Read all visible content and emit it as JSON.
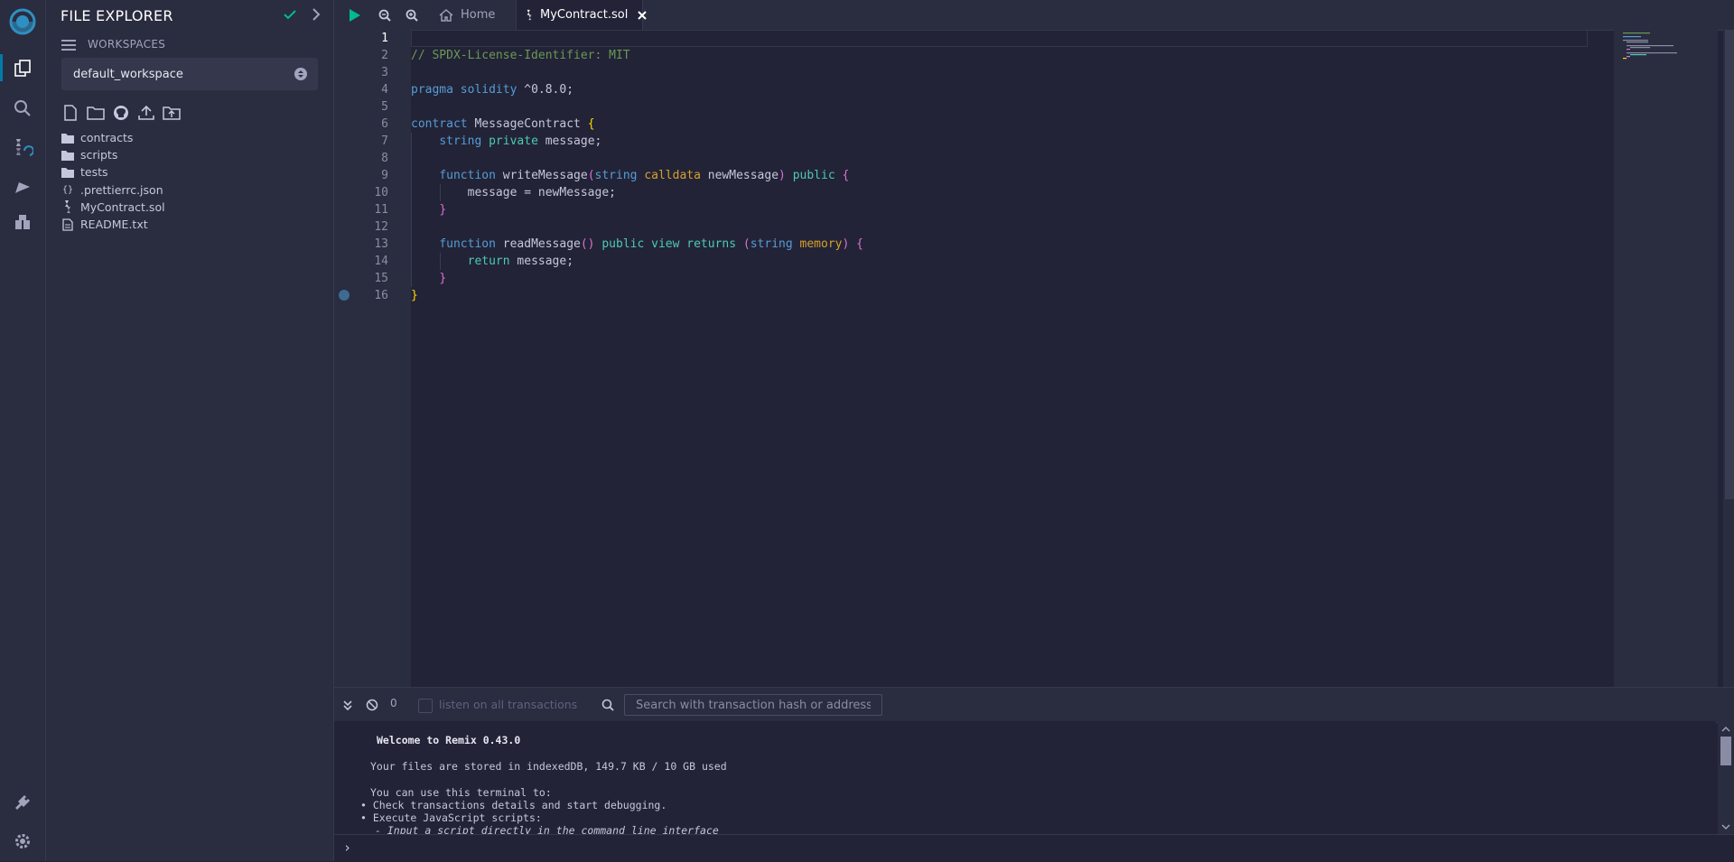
{
  "sidepanel": {
    "title": "FILE EXPLORER",
    "workspaces_label": "WORKSPACES",
    "workspace_selected": "default_workspace",
    "tree": [
      {
        "label": "contracts",
        "icon": "folder-icon"
      },
      {
        "label": "scripts",
        "icon": "folder-icon"
      },
      {
        "label": "tests",
        "icon": "folder-icon"
      },
      {
        "label": ".prettierrc.json",
        "icon": "braces-icon"
      },
      {
        "label": "MyContract.sol",
        "icon": "solidity-icon"
      },
      {
        "label": "README.txt",
        "icon": "file-text-icon"
      }
    ]
  },
  "editor": {
    "tabs": {
      "home": "Home",
      "file": "MyContract.sol"
    },
    "current_line": 1,
    "lines": [
      "1",
      "2",
      "3",
      "4",
      "5",
      "6",
      "7",
      "8",
      "9",
      "10",
      "11",
      "12",
      "13",
      "14",
      "15",
      "16"
    ],
    "code": {
      "l2": "// SPDX-License-Identifier: MIT",
      "l4_kw": "pragma",
      "l4_kw2": "solidity",
      "l4_rest": "^0.8.0;",
      "l6_kw": "contract",
      "l6_name": "MessageContract",
      "l7_type": "string",
      "l7_vis": "private",
      "l7_name": "message;",
      "l9_kw": "function",
      "l9_name": "writeMessage",
      "l9_type": "string",
      "l9_loc": "calldata",
      "l9_param": "newMessage",
      "l9_vis": "public",
      "l10": "message = newMessage;",
      "l13_kw": "function",
      "l13_name": "readMessage",
      "l13_vis": "public",
      "l13_view": "view",
      "l13_returns": "returns",
      "l13_type": "string",
      "l13_loc": "memory",
      "l14_kw": "return",
      "l14_rest": "message;",
      "open_paren": "(",
      "close_paren": ")",
      "open_brace": "{",
      "close_brace": "}",
      "empty_parens": "()"
    }
  },
  "terminal": {
    "pending_count": "0",
    "listen_label": "listen on all transactions",
    "search_placeholder": "Search with transaction hash or address",
    "welcome": "Welcome to Remix 0.43.0",
    "storage": "Your files are stored in indexedDB, 149.7 KB / 10 GB used",
    "can_use": "You can use this terminal to:",
    "bullets": [
      "Check transactions details and start debugging.",
      "Execute JavaScript scripts:",
      "- Input a script directly in the command line interface"
    ],
    "prompt": "›"
  },
  "colors": {
    "accent": "#007aa6",
    "run": "#00bc8c",
    "check": "#00bc8c"
  }
}
